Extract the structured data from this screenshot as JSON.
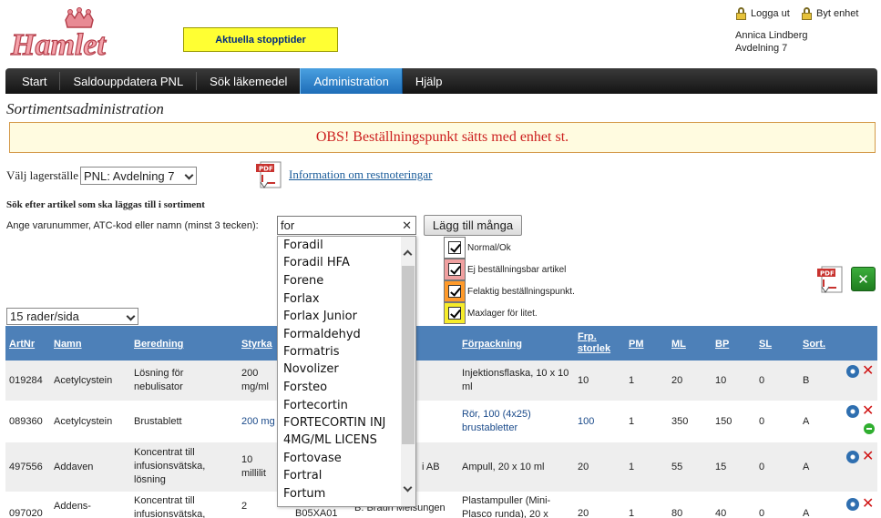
{
  "header": {
    "logo_text": "Hamlet",
    "stop_button": "Aktuella stopptider",
    "logout": "Logga ut",
    "change_unit": "Byt enhet",
    "user_name": "Annica Lindberg",
    "user_unit": "Avdelning 7"
  },
  "nav": {
    "items": [
      "Start",
      "Saldouppdatera PNL",
      "Sök läkemedel",
      "Administration",
      "Hjälp"
    ],
    "active": "Administration"
  },
  "page": {
    "title": "Sortimentsadministration",
    "notice": "OBS! Beställningspunkt sätts med enhet st.",
    "lager_label": "Välj lagerställe",
    "lager_value": "PNL: Avdelning 7",
    "info_link": "Information om restnoteringar",
    "search_heading": "Sök efter artikel som ska läggas till i sortiment",
    "search_label": "Ange varunummer, ATC-kod eller namn (minst 3 tecken):",
    "search_value": "for",
    "add_many_button": "Lägg till många",
    "rows_per_page": "15 rader/sida"
  },
  "legend": [
    {
      "label": "Normal/Ok",
      "color": "#ffffff"
    },
    {
      "label": "Ej beställningsbar artikel",
      "color": "#f0a0a0"
    },
    {
      "label": "Felaktig beställningspunkt.",
      "color": "#ff9a2a"
    },
    {
      "label": "Maxlager för litet.",
      "color": "#f6ec2a"
    }
  ],
  "autocomplete": {
    "items": [
      "Foradil",
      "Foradil HFA",
      "Forene",
      "Forlax",
      "Forlax Junior",
      "Formaldehyd",
      "Formatris",
      "Novolizer",
      "Forsteo",
      "Fortecortin",
      "FORTECORTIN INJ",
      "4MG/ML LICENS",
      "Fortovase",
      "Fortral",
      "Fortum"
    ]
  },
  "table": {
    "headers": [
      "ArtNr",
      "Namn",
      "Beredning",
      "Styrka",
      "",
      "Förpackning",
      "Frp. storlek",
      "PM",
      "ML",
      "BP",
      "SL",
      "Sort."
    ],
    "rows": [
      {
        "artnr": "019284",
        "namn": "Acetylcystein",
        "beredning": "Lösning för nebulisator",
        "styrka": "200 mg/ml",
        "atc": "",
        "tillverkare": "",
        "forpackning": "Injektionsflaska, 10 x 10 ml",
        "frp": "10",
        "pm": "1",
        "ml": "20",
        "bp": "10",
        "sl": "0",
        "sort": "B"
      },
      {
        "artnr": "089360",
        "namn": "Acetylcystein",
        "beredning": "Brustablett",
        "styrka": "200 mg",
        "atc": "",
        "tillverkare": "",
        "forpackning": "Rör, 100 (4x25) brustabletter",
        "frp": "100",
        "pm": "1",
        "ml": "350",
        "bp": "150",
        "sl": "0",
        "sort": "A"
      },
      {
        "artnr": "497556",
        "namn": "Addaven",
        "beredning": "Koncentrat till infusionsvätska, lösning",
        "styrka": "10 millilit",
        "atc": "",
        "tillverkare": "i AB",
        "forpackning": "Ampull, 20 x 10 ml",
        "frp": "20",
        "pm": "1",
        "ml": "55",
        "bp": "15",
        "sl": "0",
        "sort": "A"
      },
      {
        "artnr": "097020",
        "namn": "Addens-",
        "beredning": "Koncentrat till infusionsvätska,",
        "styrka": "2",
        "atc": "B05XA01",
        "tillverkare": "B. Braun Melsungen",
        "forpackning": "Plastampuller (Mini-Plasco runda), 20 x",
        "frp": "20",
        "pm": "1",
        "ml": "80",
        "bp": "40",
        "sl": "0",
        "sort": "A"
      }
    ]
  }
}
